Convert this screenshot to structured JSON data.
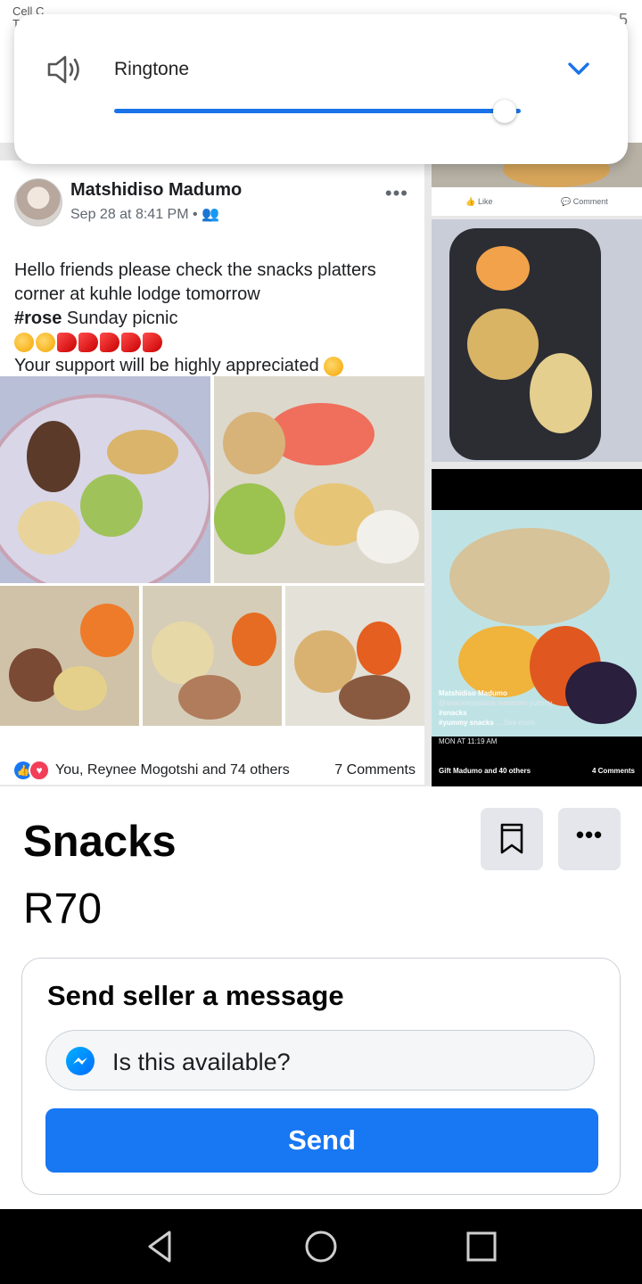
{
  "status_bar": {
    "carrier": "Cell C",
    "carrier_line2": "T",
    "time": "5"
  },
  "volume": {
    "label": "Ringtone",
    "level": 0.96,
    "accent": "#1a73e8"
  },
  "post": {
    "author": "Matshidiso Madumo",
    "meta": "Sep 28 at 8:41 PM • ",
    "more": "•••",
    "text_line1": "Hello friends please check the snacks platters",
    "text_line2": "corner at kuhle lodge tomorrow",
    "hashtag": "#rose",
    "text_line3": " Sunday picnic",
    "text_line4": "Your support will be highly appreciated",
    "reactions": "You, Reynee Mogotshi and 74 others",
    "comments": "7 Comments"
  },
  "inner_post": {
    "like": "Like",
    "comment": "Comment",
    "caption_author": "Matshidiso Madumo",
    "caption_handle": "@snackerspalace",
    "caption_extra": "mmmmm yummy",
    "caption_tag1": "#snacks",
    "caption_tag2": "#yummy snacks",
    "caption_more": "... See more",
    "caption_time": "MON AT 11:19 AM",
    "reactions": "Gift Madumo and 40 others",
    "comments": "4 Comments"
  },
  "listing": {
    "title": "Snacks",
    "price": "R70",
    "save_icon": "bookmark-icon",
    "more_label": "•••"
  },
  "message": {
    "heading": "Send seller a message",
    "input_value": "Is this available?",
    "send_label": "Send",
    "accent": "#1877f2"
  }
}
